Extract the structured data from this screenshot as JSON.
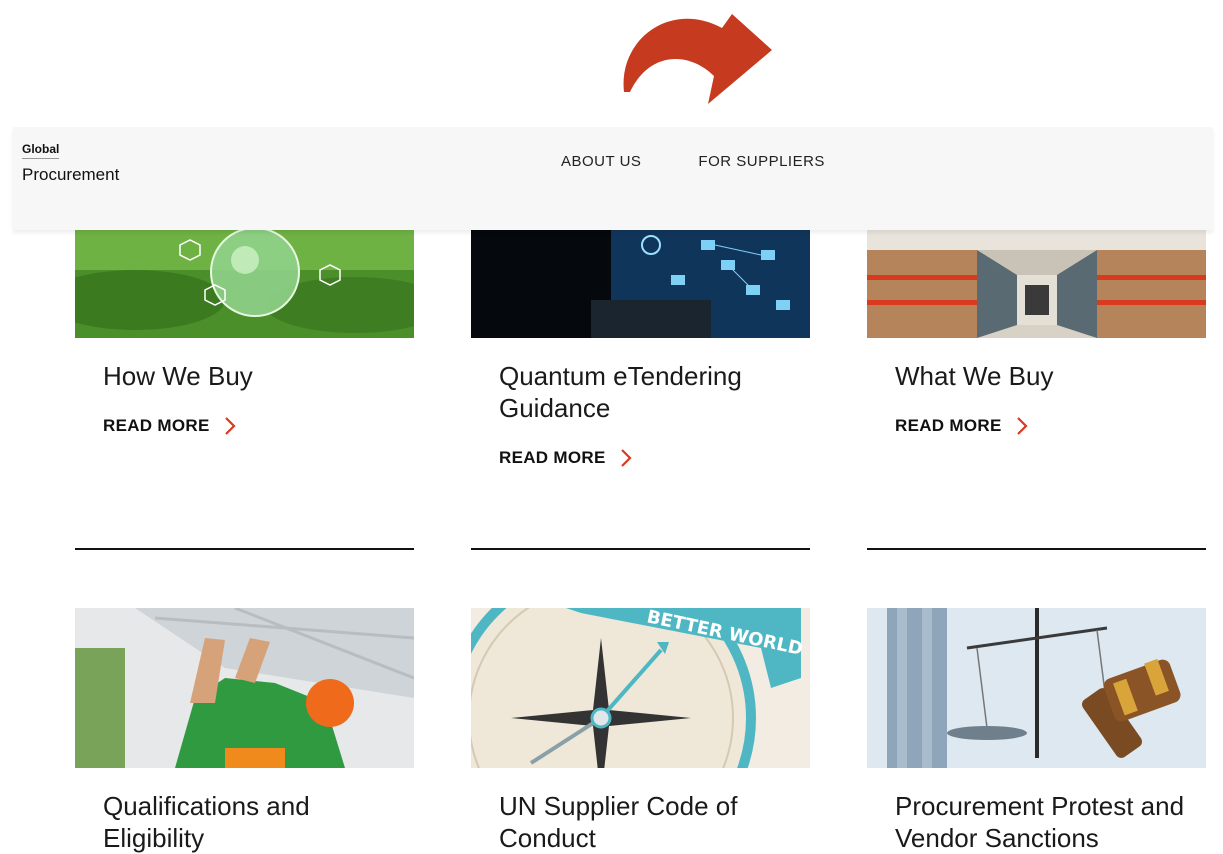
{
  "header": {
    "brand_top": "Global",
    "brand_bottom": "Procurement",
    "nav": [
      "ABOUT US",
      "FOR SUPPLIERS"
    ]
  },
  "annotation": {
    "arrow_color": "#c63b1f",
    "icon": "curved-arrow-icon"
  },
  "cards_row1": [
    {
      "title": "How We Buy",
      "link": "READ MORE",
      "image": "green-globe-sustainability"
    },
    {
      "title": "Quantum eTendering Guidance",
      "link": "READ MORE",
      "image": "laptop-network-icons"
    },
    {
      "title": "What We Buy",
      "link": "READ MORE",
      "image": "warehouse-shelves"
    }
  ],
  "cards_row2": [
    {
      "title": "Qualifications and Eligibility",
      "image": "worker-solar-panel"
    },
    {
      "title": "UN Supplier Code of Conduct",
      "image": "compass-better-world",
      "image_text": "BETTER WORLD"
    },
    {
      "title": "Procurement Protest and Vendor Sanctions",
      "image": "scales-gavel"
    }
  ],
  "colors": {
    "accent": "#d9391f",
    "text": "#1a1a1a",
    "header_bg": "#f7f7f7"
  }
}
